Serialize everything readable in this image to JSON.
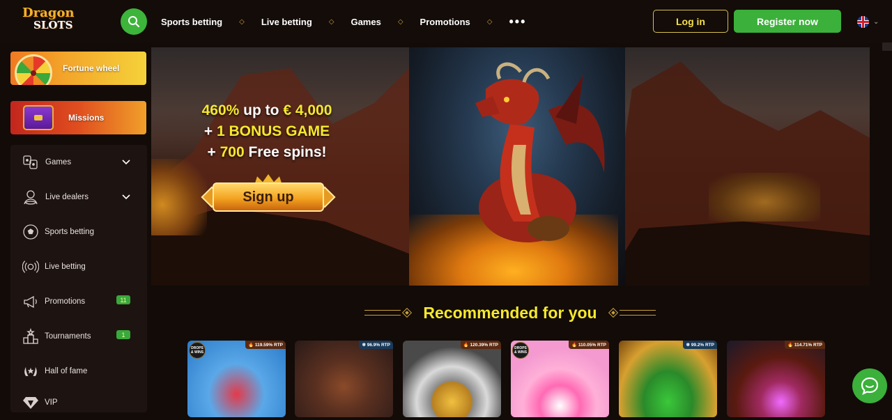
{
  "brand": {
    "line1": "Dragon",
    "line2": "SLOTS"
  },
  "header": {
    "nav": [
      "Sports betting",
      "Live betting",
      "Games",
      "Promotions"
    ],
    "more": "•••",
    "login": "Log in",
    "register": "Register now"
  },
  "sidebar": {
    "fortune": "Fortune wheel",
    "missions": "Missions",
    "items": [
      {
        "label": "Games",
        "icon": "games-icon"
      },
      {
        "label": "Live dealers",
        "icon": "live-dealers-icon"
      },
      {
        "label": "Sports betting",
        "icon": "soccer-ball-icon"
      },
      {
        "label": "Live betting",
        "icon": "live-broadcast-icon"
      },
      {
        "label": "Promotions",
        "icon": "megaphone-icon",
        "badge": "11"
      },
      {
        "label": "Tournaments",
        "icon": "tournament-icon",
        "badge": "1"
      },
      {
        "label": "Hall of fame",
        "icon": "laurel-icon"
      },
      {
        "label": "VIP",
        "icon": "diamond-icon"
      }
    ]
  },
  "hero": {
    "line1_a": "460%",
    "line1_b": " up to ",
    "line1_c": "€ 4,000",
    "line2_a": "+ ",
    "line2_b": "1 BONUS GAME",
    "line3_a": "+ ",
    "line3_b": "700",
    "line3_c": " Free spins!",
    "cta": "Sign up"
  },
  "recommended": {
    "title": "Recommended for you",
    "games": [
      {
        "rtp": "119.59% RTP",
        "hot": true,
        "drops": true
      },
      {
        "rtp": "96.9% RTP",
        "hot": false,
        "drops": false
      },
      {
        "rtp": "120.39% RTP",
        "hot": true,
        "drops": false
      },
      {
        "rtp": "110.05% RTP",
        "hot": true,
        "drops": true
      },
      {
        "rtp": "99.2% RTP",
        "hot": false,
        "drops": false
      },
      {
        "rtp": "114.71% RTP",
        "hot": true,
        "drops": false
      }
    ],
    "drops_label": "DROPS & WINS"
  },
  "colors": {
    "accent_green": "#3bb03a",
    "accent_yellow": "#f5e82e",
    "gold": "#c9a13a"
  }
}
